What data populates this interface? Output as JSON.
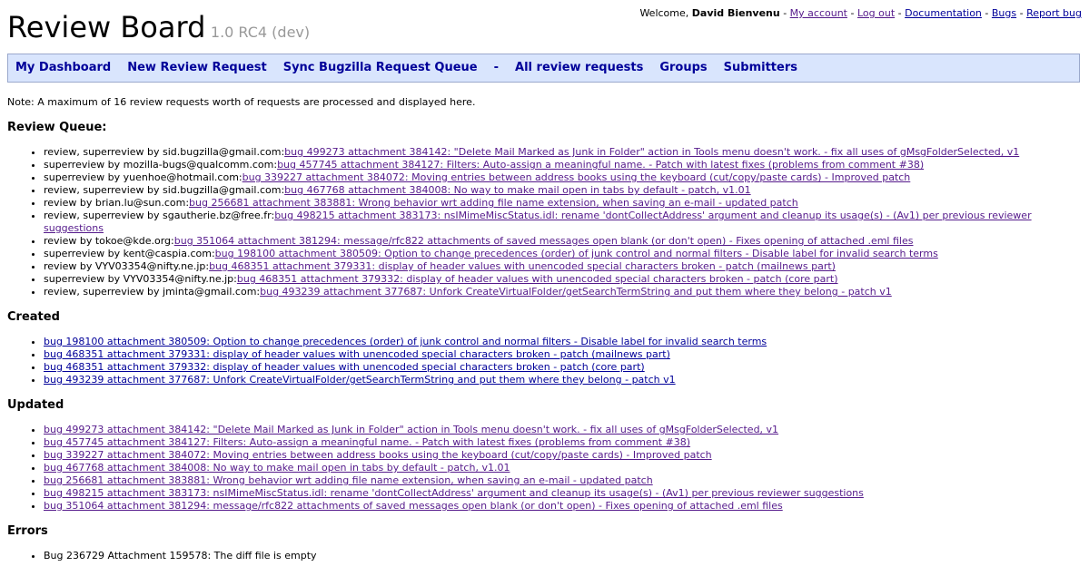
{
  "header": {
    "title": "Review Board",
    "version": "1.0 RC4 (dev)",
    "welcome_prefix": "Welcome, ",
    "user": "David Bienvenu",
    "sep": " - ",
    "links": [
      "My account",
      "Log out",
      "Documentation",
      "Bugs",
      "Report bug"
    ]
  },
  "navbar": {
    "items": [
      "My Dashboard",
      "New Review Request",
      "Sync Bugzilla Request Queue",
      "-",
      "All review requests",
      "Groups",
      "Submitters"
    ]
  },
  "note": "Note: A maximum of 16 review requests worth of requests are processed and displayed here.",
  "sections": {
    "queue_title": "Review Queue:",
    "created_title": "Created",
    "updated_title": "Updated",
    "errors_title": "Errors"
  },
  "queue": [
    {
      "prefix": "review, superreview by sid.bugzilla@gmail.com:",
      "link": "bug 499273 attachment 384142: \"Delete Mail Marked as Junk in Folder\" action in Tools menu doesn't work. - fix all uses of gMsgFolderSelected, v1"
    },
    {
      "prefix": "superreview by mozilla-bugs@qualcomm.com:",
      "link": "bug 457745 attachment 384127: Filters: Auto-assign a meaningful name. - Patch with latest fixes (problems from comment #38)"
    },
    {
      "prefix": "superreview by yuenhoe@hotmail.com:",
      "link": "bug 339227 attachment 384072: Moving entries between address books using the keyboard (cut/copy/paste cards) - Improved patch"
    },
    {
      "prefix": "review, superreview by sid.bugzilla@gmail.com:",
      "link": "bug 467768 attachment 384008: No way to make mail open in tabs by default - patch, v1.01"
    },
    {
      "prefix": "review by brian.lu@sun.com:",
      "link": "bug 256681 attachment 383881: Wrong behavior wrt adding file name extension, when saving an e-mail - updated patch"
    },
    {
      "prefix": "review, superreview by sgautherie.bz@free.fr:",
      "link": "bug 498215 attachment 383173: nsIMimeMiscStatus.idl: rename 'dontCollectAddress' argument and cleanup its usage(s) - (Av1) per previous reviewer suggestions"
    },
    {
      "prefix": "review by tokoe@kde.org:",
      "link": "bug 351064 attachment 381294: message/rfc822 attachments of saved messages open blank (or don't open) - Fixes opening of attached .eml files"
    },
    {
      "prefix": "superreview by kent@caspia.com:",
      "link": "bug 198100 attachment 380509: Option to change precedences (order) of junk control and normal filters - Disable label for invalid search terms"
    },
    {
      "prefix": "review by VYV03354@nifty.ne.jp:",
      "link": "bug 468351 attachment 379331: display of header values with unencoded special characters broken - patch (mailnews part)"
    },
    {
      "prefix": "superreview by VYV03354@nifty.ne.jp:",
      "link": "bug 468351 attachment 379332: display of header values with unencoded special characters broken - patch (core part)"
    },
    {
      "prefix": "review, superreview by jminta@gmail.com:",
      "link": "bug 493239 attachment 377687: Unfork CreateVirtualFolder/getSearchTermString and put them where they belong - patch v1"
    }
  ],
  "created": [
    "bug 198100 attachment 380509: Option to change precedences (order) of junk control and normal filters - Disable label for invalid search terms",
    "bug 468351 attachment 379331: display of header values with unencoded special characters broken - patch (mailnews part)",
    "bug 468351 attachment 379332: display of header values with unencoded special characters broken - patch (core part)",
    "bug 493239 attachment 377687: Unfork CreateVirtualFolder/getSearchTermString and put them where they belong - patch v1"
  ],
  "updated": [
    "bug 499273 attachment 384142: \"Delete Mail Marked as Junk in Folder\" action in Tools menu doesn't work. - fix all uses of gMsgFolderSelected, v1",
    "bug 457745 attachment 384127: Filters: Auto-assign a meaningful name. - Patch with latest fixes (problems from comment #38)",
    "bug 339227 attachment 384072: Moving entries between address books using the keyboard (cut/copy/paste cards) - Improved patch",
    "bug 467768 attachment 384008: No way to make mail open in tabs by default - patch, v1.01",
    "bug 256681 attachment 383881: Wrong behavior wrt adding file name extension, when saving an e-mail - updated patch",
    "bug 498215 attachment 383173: nsIMimeMiscStatus.idl: rename 'dontCollectAddress' argument and cleanup its usage(s) - (Av1) per previous reviewer suggestions",
    "bug 351064 attachment 381294: message/rfc822 attachments of saved messages open blank (or don't open) - Fixes opening of attached .eml files"
  ],
  "errors": [
    "Bug 236729 Attachment 159578: The diff file is empty"
  ],
  "colors": {
    "link": "#000099",
    "visited_link": "#551a8b",
    "navbar_bg": "#d9e5fd",
    "navbar_border": "#9aa8cc",
    "version": "#999999"
  }
}
